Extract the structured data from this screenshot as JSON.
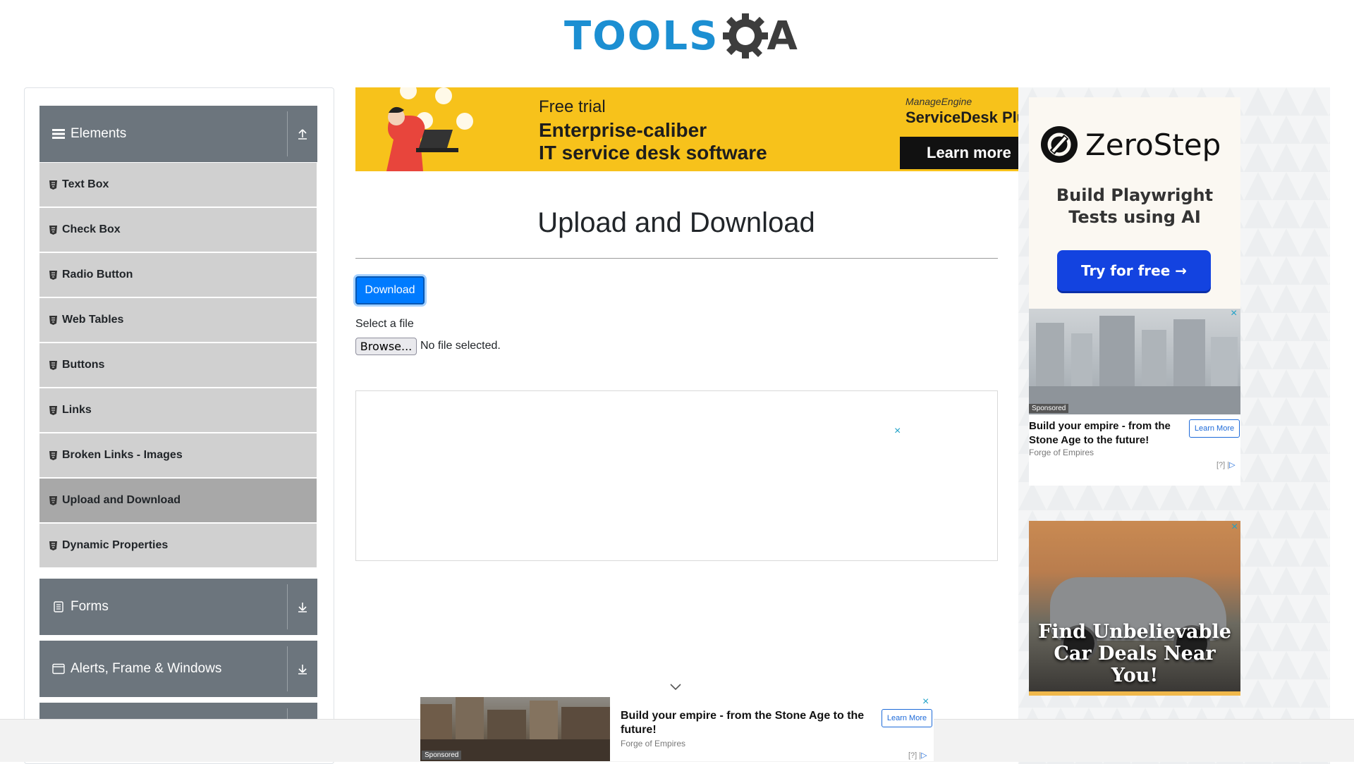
{
  "header": {
    "logo_tools": "TOOLS",
    "logo_a": "A"
  },
  "sidebar": {
    "groups": [
      {
        "label": "Elements",
        "icon": "hamburger-icon",
        "expanded": true
      },
      {
        "label": "Forms",
        "icon": "document-icon",
        "expanded": false
      },
      {
        "label": "Alerts, Frame & Windows",
        "icon": "window-icon",
        "expanded": false
      }
    ],
    "items": [
      {
        "label": "Text Box"
      },
      {
        "label": "Check Box"
      },
      {
        "label": "Radio Button"
      },
      {
        "label": "Web Tables"
      },
      {
        "label": "Buttons"
      },
      {
        "label": "Links"
      },
      {
        "label": "Broken Links - Images"
      },
      {
        "label": "Upload and Download",
        "active": true
      },
      {
        "label": "Dynamic Properties"
      }
    ]
  },
  "top_ad": {
    "line1": "Free trial",
    "line2": "Enterprise-caliber",
    "line3": "IT service desk software",
    "brand1": "ManageEngine",
    "brand2": "ServiceDesk Plu",
    "cta": "Learn more"
  },
  "main": {
    "title": "Upload and Download",
    "download_label": "Download",
    "select_label": "Select a file",
    "browse_label": "Browse...",
    "no_file": "No file selected.",
    "ad_close": "×"
  },
  "right_ads": {
    "zerostep": {
      "name": "ZeroStep",
      "tagline_1": "Build Playwright",
      "tagline_2": "Tests using AI",
      "cta": "Try for free →"
    },
    "empire": {
      "sponsored": "Sponsored",
      "title": "Build your empire - from the Stone Age to the future!",
      "source": "Forge of Empires",
      "learn": "Learn More",
      "info": "[?] |",
      "close": "×"
    },
    "car": {
      "line1": "Find Unbelievable",
      "line2": "Car Deals Near",
      "line3": "You!",
      "close": "×"
    }
  },
  "bottom_ad": {
    "sponsored": "Sponsored",
    "title": "Build your empire - from the Stone Age to the future!",
    "source": "Forge of Empires",
    "learn": "Learn More",
    "info": "[?] |",
    "close": "×"
  },
  "colors": {
    "accent": "#007bff",
    "sidebar_header": "#6c757d",
    "sidebar_item": "#d0d0d0",
    "sidebar_item_active": "#a8a8a8",
    "logo_blue": "#1c8fd2"
  }
}
